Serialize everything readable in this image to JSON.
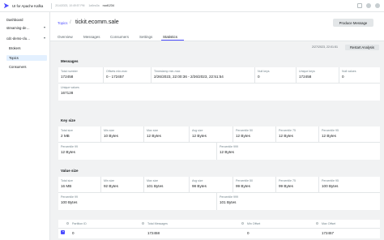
{
  "topbar": {
    "app_title": "UI for Apache Kafka",
    "meta_1": "2/14/2023, 10:49:57 PM",
    "meta_2": "1a6ea3a",
    "user": "root1234",
    "icons": [
      "user-icon",
      "discord-icon",
      "github-icon"
    ]
  },
  "sidebar": {
    "dashboard": "Dashboard",
    "cluster_1": "streaming-de…",
    "cluster_2": "cdc-demo-clu…",
    "brokers": "Brokers",
    "topics": "Topics",
    "consumers": "Consumers"
  },
  "header": {
    "breadcrumb": "Topics",
    "separator": "/",
    "title": "tickit.ecomm.sale",
    "produce_button": "Produce Message"
  },
  "tabs": [
    "Overview",
    "Messages",
    "Consumers",
    "Settings",
    "Statistics"
  ],
  "stats": {
    "date": "2/27/2023, 22:01:51",
    "restart_button": "Restart Analysis",
    "messages": {
      "title": "Messages",
      "row1": [
        {
          "label": "Total number",
          "value": "172458"
        },
        {
          "label": "Offsets min-max",
          "value": "0 - 172457"
        },
        {
          "label": "Timestamp min-max",
          "value": "2/26/2023, 22:00:36 - 2/26/2023, 22:51:54"
        },
        {
          "label": "Null keys",
          "value": "0"
        },
        {
          "label": "Unique keys",
          "value": "172458"
        },
        {
          "label": "Null values",
          "value": "0"
        }
      ],
      "row2": [
        {
          "label": "Unique values",
          "value": "167128"
        }
      ]
    },
    "key_size": {
      "title": "Key size",
      "row1": [
        {
          "label": "Total size",
          "value": "2 MB"
        },
        {
          "label": "Min size",
          "value": "10 Bytes"
        },
        {
          "label": "Max size",
          "value": "12 Bytes"
        },
        {
          "label": "Avg size",
          "value": "12 Bytes"
        },
        {
          "label": "Percentile 50",
          "value": "12 Bytes"
        },
        {
          "label": "Percentile 75",
          "value": "12 Bytes"
        },
        {
          "label": "Percentile 95",
          "value": "12 Bytes"
        }
      ],
      "row2": [
        {
          "label": "Percentile 99",
          "value": "12 Bytes"
        },
        {
          "label": "Percentile 999",
          "value": "12 Bytes"
        }
      ]
    },
    "value_size": {
      "title": "Value size",
      "row1": [
        {
          "label": "Total size",
          "value": "16 MB"
        },
        {
          "label": "Min size",
          "value": "92 Bytes"
        },
        {
          "label": "Max size",
          "value": "101 Bytes"
        },
        {
          "label": "Avg size",
          "value": "98 Bytes"
        },
        {
          "label": "Percentile 50",
          "value": "99 Bytes"
        },
        {
          "label": "Percentile 75",
          "value": "99 Bytes"
        },
        {
          "label": "Percentile 95",
          "value": "100 Bytes"
        }
      ],
      "row2": [
        {
          "label": "Percentile 99",
          "value": "100 Bytes"
        },
        {
          "label": "Percentile 999",
          "value": "101 Bytes"
        }
      ]
    },
    "partitions": {
      "headers": [
        "Partition ID",
        "Total Messages",
        "Min Offset",
        "Max Offset"
      ],
      "rows": [
        [
          "0",
          "172458",
          "0",
          "172457"
        ]
      ]
    }
  },
  "colors": {
    "accent": "#4c4cff",
    "active_bg": "#e3f0ff",
    "panel_bg": "#f1f2f3"
  }
}
